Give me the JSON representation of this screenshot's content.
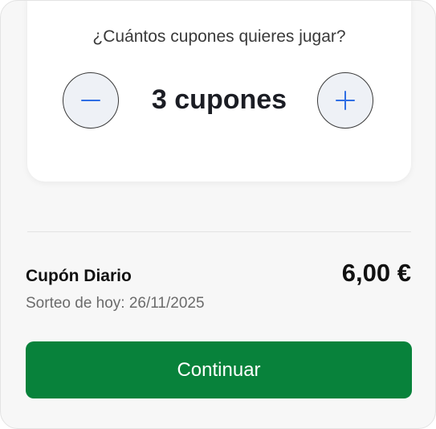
{
  "selector": {
    "question": "¿Cuántos cupones quieres jugar?",
    "count_label": "3 cupones",
    "decrement_icon": "minus-icon",
    "increment_icon": "plus-icon"
  },
  "summary": {
    "product_name": "Cupón Diario",
    "draw_date": "Sorteo de hoy: 26/11/2025",
    "price": "6,00 €"
  },
  "actions": {
    "continue_label": "Continuar"
  },
  "colors": {
    "primary_button": "#08823b",
    "stepper_icon": "#2f6fe4",
    "stepper_background": "#eef1f6",
    "text_dark": "#1b1d24",
    "text_muted": "#6b6b6b"
  }
}
